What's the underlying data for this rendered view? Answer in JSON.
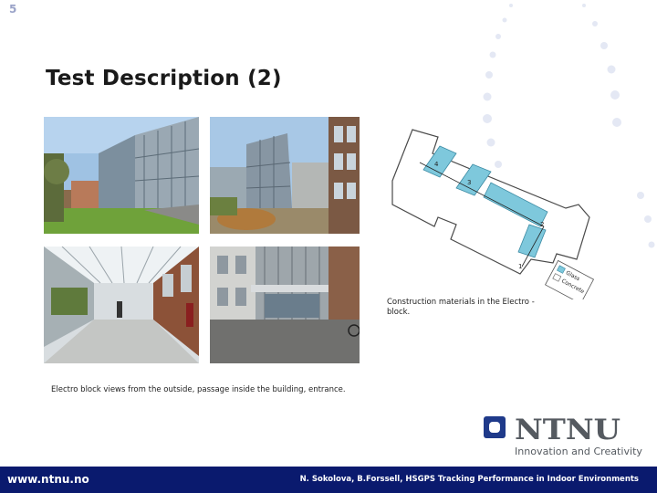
{
  "slide_number": "5",
  "title": "Test Description (2)",
  "photos_caption": "Electro block views from the outside, passage inside the building, entrance.",
  "plan_caption": "Construction materials in the Electro - block.",
  "plan": {
    "labels": [
      "4",
      "3",
      "2",
      "1"
    ],
    "legend": [
      "Glass",
      "Concrete"
    ],
    "glass_color": "#7ec8dc"
  },
  "logo": {
    "name": "NTNU",
    "tagline": "Innovation and Creativity"
  },
  "footer": {
    "url": "www.ntnu.no",
    "credit": "N. Sokolova, B.Forssell, HSGPS Tracking Performance in Indoor Environments"
  },
  "colors": {
    "footer_bg": "#0a1a6e",
    "logo_blue": "#1f3a8a",
    "dots": "#e4e8f4"
  }
}
